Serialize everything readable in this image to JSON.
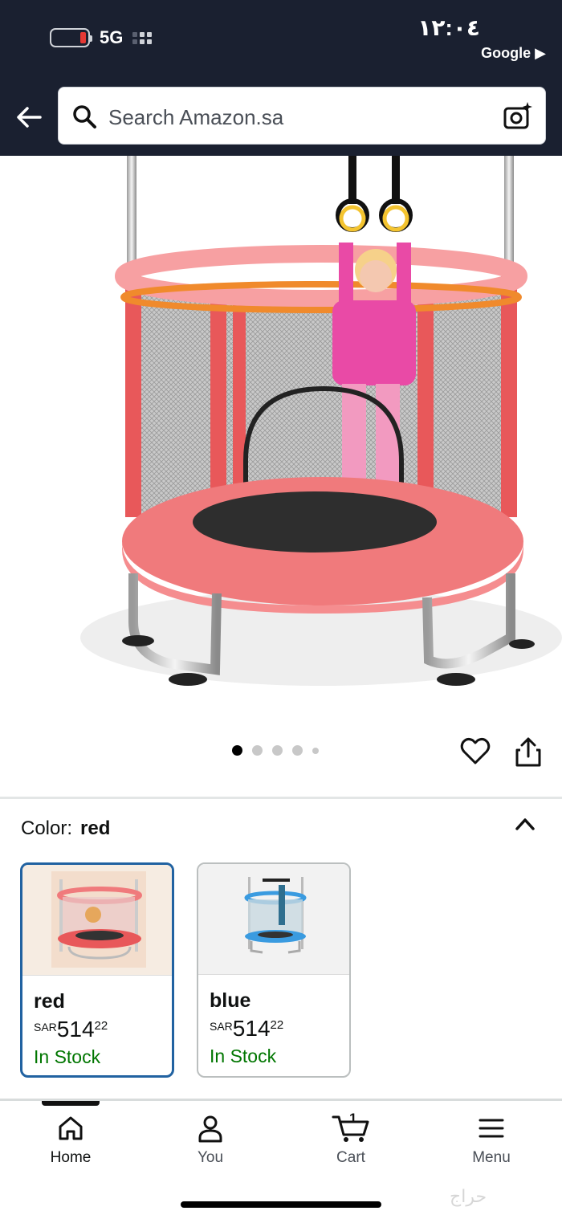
{
  "status_bar": {
    "network": "5G",
    "time": "١٢:٠٤",
    "back_to_app": "Google ▶"
  },
  "search": {
    "placeholder": "Search Amazon.sa"
  },
  "gallery": {
    "image_description_icon": "trampoline-product-photo",
    "page_count": 5,
    "current_page": 1
  },
  "variation": {
    "label": "Color:",
    "selected": "red",
    "options": [
      {
        "name": "red",
        "currency": "SAR",
        "whole": "514",
        "fraction": "22",
        "stock": "In Stock",
        "selected": true
      },
      {
        "name": "blue",
        "currency": "SAR",
        "whole": "514",
        "fraction": "22",
        "stock": "In Stock",
        "selected": false
      }
    ]
  },
  "nav": {
    "items": [
      {
        "label": "Home",
        "icon": "home-icon",
        "active": true
      },
      {
        "label": "You",
        "icon": "user-icon",
        "active": false
      },
      {
        "label": "Cart",
        "icon": "cart-icon",
        "active": false,
        "count": "1"
      },
      {
        "label": "Menu",
        "icon": "menu-icon",
        "active": false
      }
    ]
  },
  "colors": {
    "header_bg": "#1a2030",
    "selected_border": "#2162a1",
    "in_stock": "#007600",
    "trampoline_pink": "#f0787a"
  },
  "watermark": "حراج"
}
